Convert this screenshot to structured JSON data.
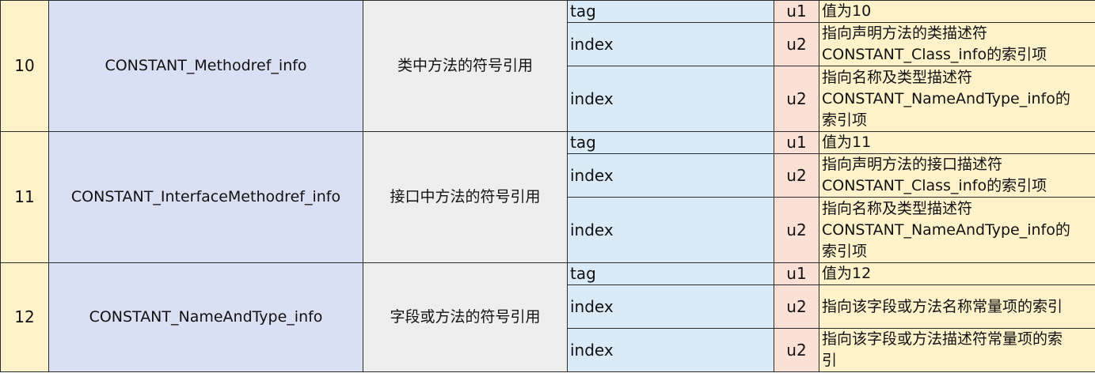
{
  "rows": [
    {
      "number": "10",
      "name": "CONSTANT_Methodref_info",
      "description": "类中方法的符号引用",
      "items": [
        {
          "field": "tag",
          "type": "u1",
          "note": [
            "值为10"
          ]
        },
        {
          "field": "index",
          "type": "u2",
          "note": [
            "指向声明方法的类描述符",
            "CONSTANT_Class_info的索引项"
          ]
        },
        {
          "field": "index",
          "type": "u2",
          "note": [
            "指向名称及类型描述符",
            "CONSTANT_NameAndType_info的",
            "索引项"
          ]
        }
      ]
    },
    {
      "number": "11",
      "name": "CONSTANT_InterfaceMethodref_info",
      "description": "接口中方法的符号引用",
      "items": [
        {
          "field": "tag",
          "type": "u1",
          "note": [
            "值为11"
          ]
        },
        {
          "field": "index",
          "type": "u2",
          "note": [
            "指向声明方法的接口描述符",
            "CONSTANT_Class_info的索引项"
          ]
        },
        {
          "field": "index",
          "type": "u2",
          "note": [
            "指向名称及类型描述符",
            "CONSTANT_NameAndType_info的",
            "索引项"
          ]
        }
      ]
    },
    {
      "number": "12",
      "name": "CONSTANT_NameAndType_info",
      "description": "字段或方法的符号引用",
      "items": [
        {
          "field": "tag",
          "type": "u1",
          "note": [
            "值为12"
          ]
        },
        {
          "field": "index",
          "type": "u2",
          "note": [
            "指向该字段或方法名称常量项的索引"
          ]
        },
        {
          "field": "index",
          "type": "u2",
          "note": [
            "指向该字段或方法描述符常量项的索",
            "引"
          ]
        }
      ]
    }
  ],
  "colors": {
    "number_bg": "#fef2cb",
    "name_bg": "#d9e0f3",
    "description_bg": "#eeeeee",
    "field_bg": "#dbeaf7",
    "type_bg": "#fbe0d6",
    "note_bg": "#fef2cb"
  }
}
